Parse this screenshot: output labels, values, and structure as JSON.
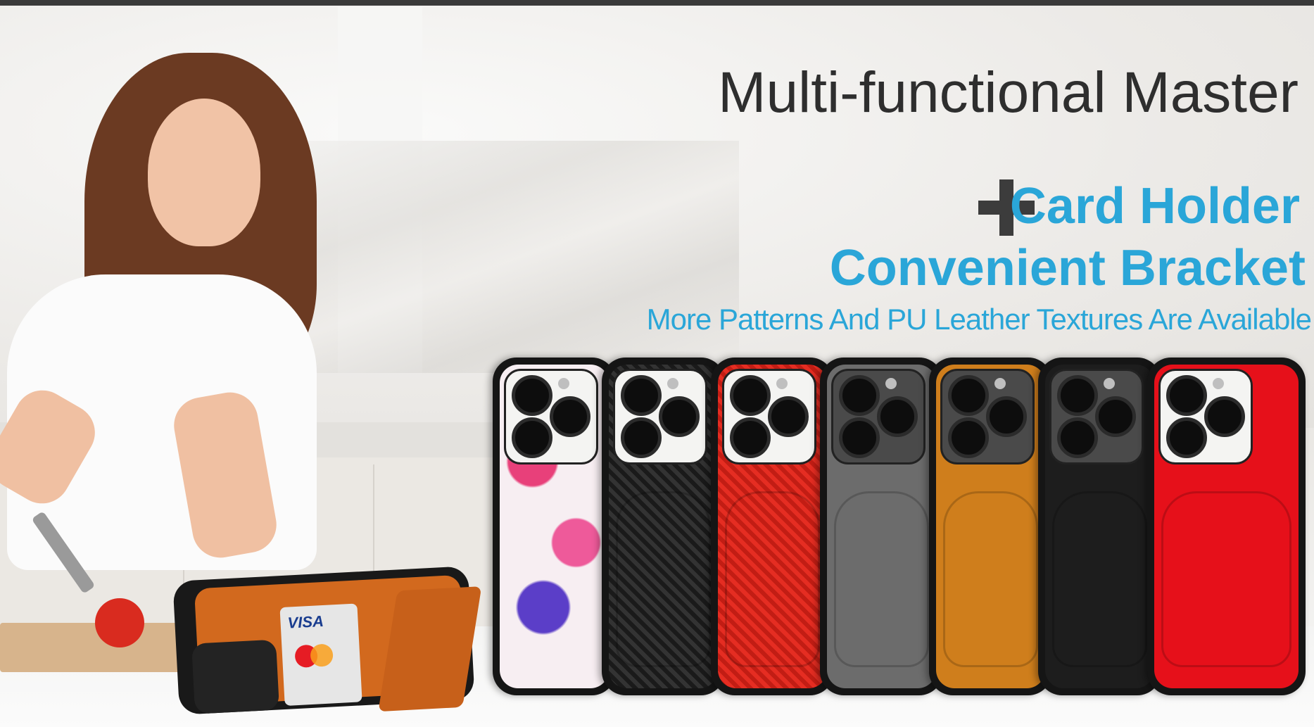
{
  "banner": {
    "headline": "Multi-functional Master",
    "feature_1": "Card Holder",
    "feature_2": "Convenient Bracket",
    "subline": "More Patterns And PU Leather Textures Are Available"
  },
  "card": {
    "brand": "VISA"
  },
  "colors": {
    "headline": "#2e2e2e",
    "accent": "#2aa6d8",
    "plus": "#3c3c3c"
  },
  "cases": [
    {
      "pattern": "floral",
      "color": "#f7eef2"
    },
    {
      "pattern": "carbon-fiber-black",
      "color": "#1a1a1a"
    },
    {
      "pattern": "carbon-fiber-red",
      "color": "#e52d22"
    },
    {
      "pattern": "leather-gray",
      "color": "#6c6c6c"
    },
    {
      "pattern": "leather-orange",
      "color": "#cf7e1c"
    },
    {
      "pattern": "leather-black",
      "color": "#1d1d1d"
    },
    {
      "pattern": "leather-red",
      "color": "#e6101a"
    }
  ]
}
